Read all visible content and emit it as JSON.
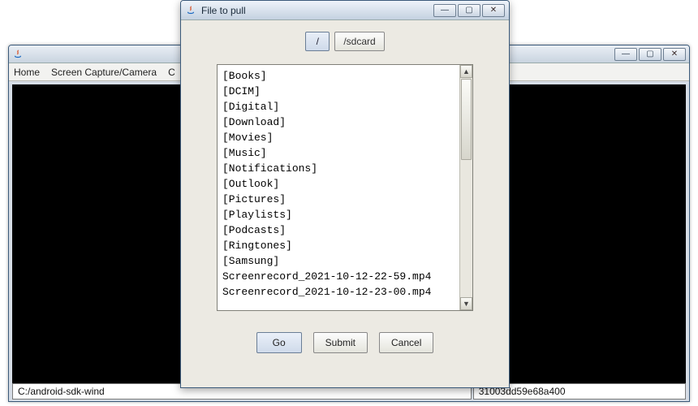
{
  "main": {
    "menubar": [
      "Home",
      "Screen Capture/Camera",
      "C"
    ],
    "status_left": "C:/android-sdk-wind",
    "status_right": "31003dd59e68a400"
  },
  "dialog": {
    "title": "File to pull",
    "path": {
      "root": "/",
      "current": "/sdcard"
    },
    "items": [
      "[Books]",
      "[DCIM]",
      "[Digital]",
      "[Download]",
      "[Movies]",
      "[Music]",
      "[Notifications]",
      "[Outlook]",
      "[Pictures]",
      "[Playlists]",
      "[Podcasts]",
      "[Ringtones]",
      "[Samsung]",
      "Screenrecord_2021-10-12-22-59.mp4",
      "Screenrecord_2021-10-12-23-00.mp4"
    ],
    "buttons": {
      "go": "Go",
      "submit": "Submit",
      "cancel": "Cancel"
    }
  },
  "winctl": {
    "min": "—",
    "max": "▢",
    "close": "✕"
  }
}
